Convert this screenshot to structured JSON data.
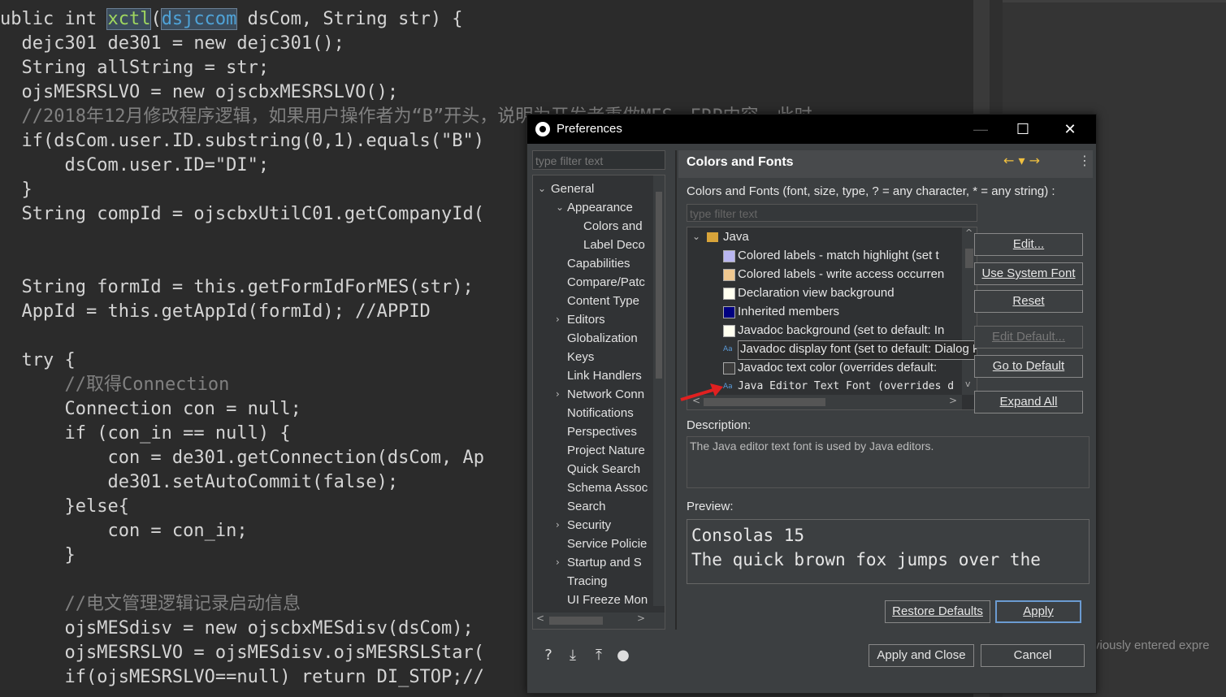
{
  "code_lines": [
    [
      "ublic int ",
      "xctl",
      "(",
      "dsjccom",
      " dsCom, String str) {"
    ],
    [
      "  dejc301 de301 = new dejc301();"
    ],
    [
      "  String allString = str;"
    ],
    [
      "  ojsMESRSLVO = new ojscbxMESRSLVO();"
    ],
    [
      "  //2018年12月修改程序逻辑，如果用户操作者为“B”开头，说明为开发者重做MES、ERP内容，此时"
    ],
    [
      "  if(dsCom.user.ID.substring(0,1).equals(\"B\")"
    ],
    [
      "      dsCom.user.ID=\"DI\";"
    ],
    [
      "  }"
    ],
    [
      "  String compId = ojscbxUtilC01.getCompanyId("
    ],
    [
      ""
    ],
    [
      ""
    ],
    [
      "  String formId = this.getFormIdForMES(str);"
    ],
    [
      "  AppId = this.getAppId(formId); //APPID"
    ],
    [
      ""
    ],
    [
      "  try {"
    ],
    [
      "      //取得Connection"
    ],
    [
      "      Connection con = null;"
    ],
    [
      "      if (con_in == null) {"
    ],
    [
      "          con = de301.getConnection(dsCom, Ap"
    ],
    [
      "          de301.setAutoCommit(false);"
    ],
    [
      "      }else{"
    ],
    [
      "          con = con_in;"
    ],
    [
      "      }"
    ],
    [
      ""
    ],
    [
      "      //电文管理逻辑记录启动信息"
    ],
    [
      "      ojsMESdisv = new ojscbxMESdisv(dsCom);"
    ],
    [
      "      ojsMESRSLVO = ojsMESdisv.ojsMESRSLStar("
    ],
    [
      "      if(ojsMESRSLVO==null) return DI_STOP;//"
    ]
  ],
  "background_panel_text": "viously entered expre",
  "dialog": {
    "title": "Preferences",
    "window_buttons": {
      "minimize": "—",
      "maximize": "☐",
      "close": "✕"
    },
    "left_filter_placeholder": "type filter text",
    "tree": [
      {
        "label": "General",
        "level": 0,
        "chevron": "expanded"
      },
      {
        "label": "Appearance",
        "level": 1,
        "chevron": "expanded"
      },
      {
        "label": "Colors and",
        "level": 2,
        "chevron": "none"
      },
      {
        "label": "Label Deco",
        "level": 2,
        "chevron": "none"
      },
      {
        "label": "Capabilities",
        "level": 1,
        "chevron": "none"
      },
      {
        "label": "Compare/Patc",
        "level": 1,
        "chevron": "none"
      },
      {
        "label": "Content Type",
        "level": 1,
        "chevron": "none"
      },
      {
        "label": "Editors",
        "level": 1,
        "chevron": "collapsed"
      },
      {
        "label": "Globalization",
        "level": 1,
        "chevron": "none"
      },
      {
        "label": "Keys",
        "level": 1,
        "chevron": "none"
      },
      {
        "label": "Link Handlers",
        "level": 1,
        "chevron": "none"
      },
      {
        "label": "Network Conn",
        "level": 1,
        "chevron": "collapsed"
      },
      {
        "label": "Notifications",
        "level": 1,
        "chevron": "none"
      },
      {
        "label": "Perspectives",
        "level": 1,
        "chevron": "none"
      },
      {
        "label": "Project Nature",
        "level": 1,
        "chevron": "none"
      },
      {
        "label": "Quick Search",
        "level": 1,
        "chevron": "none"
      },
      {
        "label": "Schema Assoc",
        "level": 1,
        "chevron": "none"
      },
      {
        "label": "Search",
        "level": 1,
        "chevron": "none"
      },
      {
        "label": "Security",
        "level": 1,
        "chevron": "collapsed"
      },
      {
        "label": "Service Policie",
        "level": 1,
        "chevron": "none"
      },
      {
        "label": "Startup and S",
        "level": 1,
        "chevron": "collapsed"
      },
      {
        "label": "Tracing",
        "level": 1,
        "chevron": "none"
      },
      {
        "label": "UI Freeze Mon",
        "level": 1,
        "chevron": "none"
      }
    ],
    "page_title": "Colors and Fonts",
    "intro": "Colors and Fonts (font, size, type, ? = any character, * = any string) :",
    "filter_placeholder": "type filter text",
    "category": "Java",
    "entries": [
      {
        "label": "Colored labels - match highlight (set t",
        "kind": "swatch",
        "color": "#b9b6f0"
      },
      {
        "label": "Colored labels - write access occurren",
        "kind": "swatch",
        "color": "#f0c890"
      },
      {
        "label": "Declaration view background",
        "kind": "swatch",
        "color": "#fffff0"
      },
      {
        "label": "Inherited members",
        "kind": "swatch",
        "color": "#000080"
      },
      {
        "label": "Javadoc background (set to default: In",
        "kind": "swatch",
        "color": "#fffff0"
      },
      {
        "label": "Javadoc display font (set to default: Dialog Font)",
        "kind": "font"
      },
      {
        "label": "Javadoc text color (overrides default:",
        "kind": "swatch",
        "color": "#3c3c3c"
      },
      {
        "label": "Java Editor Text Font (overrides d",
        "kind": "font"
      }
    ],
    "buttons": {
      "edit": "Edit...",
      "use_system_font": "Use System Font",
      "reset": "Reset",
      "edit_default": "Edit Default...",
      "go_to_default": "Go to Default",
      "expand_all": "Expand All"
    },
    "description_label": "Description:",
    "description": "The Java editor text font is used by Java editors.",
    "preview_label": "Preview:",
    "preview_lines": [
      "Consolas 15",
      "The quick brown fox jumps over the"
    ],
    "restore_defaults": "Restore Defaults",
    "apply": "Apply",
    "apply_and_close": "Apply and Close",
    "cancel": "Cancel"
  }
}
